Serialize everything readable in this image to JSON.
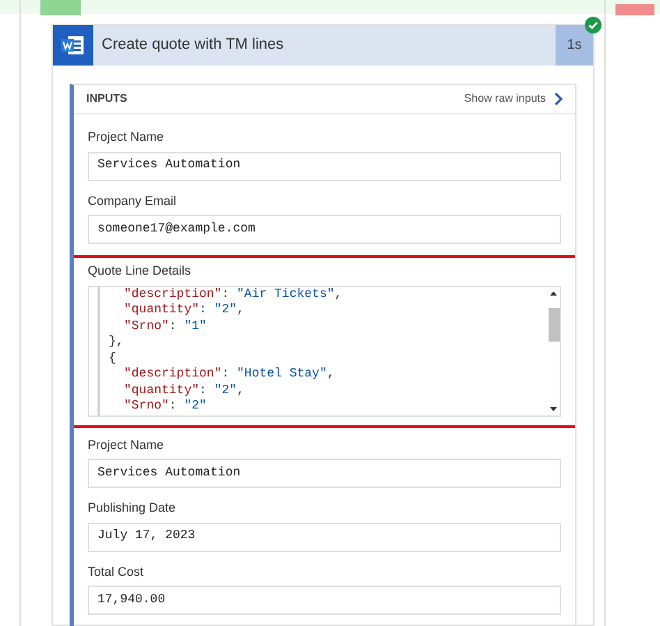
{
  "action": {
    "title": "Create quote with TM lines",
    "duration": "1s",
    "succeeded": true
  },
  "inputs": {
    "heading": "INPUTS",
    "raw_link": "Show raw inputs"
  },
  "fields": [
    {
      "kind": "text",
      "label": "Project Name",
      "value": "Services Automation",
      "highlighted": false
    },
    {
      "kind": "text",
      "label": "Company Email",
      "value": "someone17@example.com",
      "highlighted": false
    },
    {
      "kind": "code",
      "label": "Quote Line Details",
      "highlighted": true,
      "lines": [
        {
          "kind": "pair",
          "key": "\"description\"",
          "sep": ": ",
          "value": "\"Air Tickets\"",
          "end": ","
        },
        {
          "kind": "pair",
          "key": "\"quantity\"",
          "sep": ": ",
          "value": "\"2\"",
          "end": ","
        },
        {
          "kind": "pair",
          "key": "\"Srno\"",
          "sep": ": ",
          "value": "\"1\""
        },
        {
          "kind": "brace",
          "text": "},"
        },
        {
          "kind": "brace",
          "text": "{"
        },
        {
          "kind": "pair",
          "key": "\"description\"",
          "sep": ": ",
          "value": "\"Hotel Stay\"",
          "end": ","
        },
        {
          "kind": "pair",
          "key": "\"quantity\"",
          "sep": ": ",
          "value": "\"2\"",
          "end": ","
        },
        {
          "kind": "pair",
          "key": "\"Srno\"",
          "sep": ": ",
          "value": "\"2\""
        }
      ]
    },
    {
      "kind": "text",
      "label": "Project Name",
      "value": "Services Automation",
      "highlighted": false
    },
    {
      "kind": "text",
      "label": "Publishing Date",
      "value": "July 17, 2023",
      "highlighted": false
    },
    {
      "kind": "text",
      "label": "Total Cost",
      "value": "17,940.00",
      "highlighted": false
    }
  ]
}
